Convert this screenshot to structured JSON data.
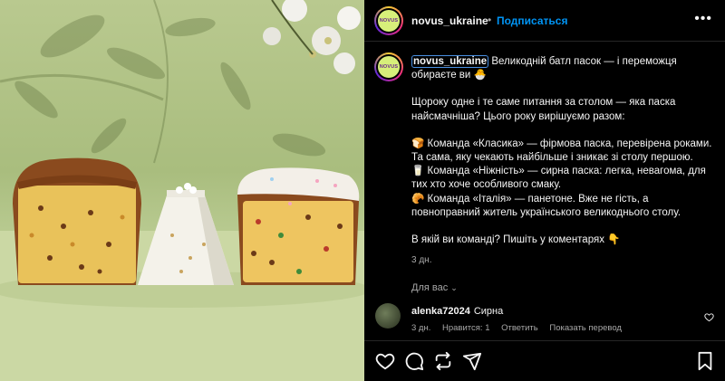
{
  "post": {
    "username": "novus_ukraine",
    "separator": "•",
    "follow_label": "Подписаться",
    "more_label": "•••",
    "avatar_text": "NOVUS"
  },
  "caption": {
    "username": "novus_ukraine",
    "lines": [
      "Великодній батл пасок — і переможця обираєте ви 🐣",
      "Щороку одне і те саме питання за столом — яка паска найсмачніша? Цього року вирішуємо разом:",
      "🍞 Команда «Класика» — фірмова паска, перевірена роками. Та сама, яку чекають найбільше і зникає зі столу першою.",
      "🥛 Команда «Ніжність» — сирна паска: легка, невагома, для тих хто хоче особливого смаку.",
      "🥐 Команда «Італія» — панетоне. Вже не гість, а повноправний житель українського великоднього столу.",
      "В якій ви команді? Пишіть у коментарях 👇"
    ],
    "time": "3 дн."
  },
  "for_you": {
    "label": "Для вас",
    "chevron": "⌄"
  },
  "comment": {
    "username": "alenka72024",
    "text": "Сирна",
    "time": "3 дн.",
    "likes": "Нравится: 1",
    "reply": "Ответить",
    "translate": "Показать перевод"
  },
  "icons": {
    "like": "heart-icon",
    "comment": "comment-icon",
    "share": "repost-icon",
    "send": "send-icon",
    "save": "bookmark-icon"
  },
  "colors": {
    "accent": "#0095f6",
    "background": "#000000",
    "muted": "#a8a8a8"
  }
}
